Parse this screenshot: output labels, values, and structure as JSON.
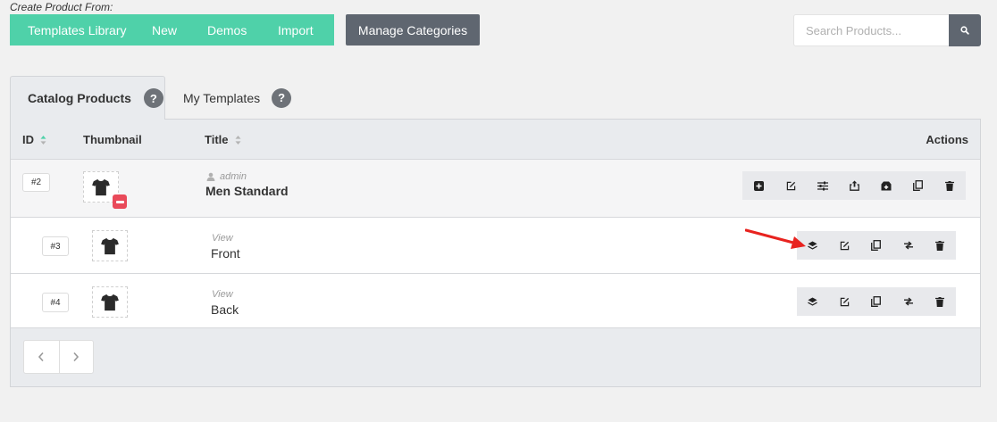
{
  "header": {
    "create_label": "Create Product From:",
    "create_buttons": [
      "Templates Library",
      "New",
      "Demos",
      "Import"
    ],
    "manage_label": "Manage Categories",
    "search_placeholder": "Search Products..."
  },
  "tabs": [
    {
      "label": "Catalog Products",
      "active": true,
      "help": "?"
    },
    {
      "label": "My Templates",
      "active": false,
      "help": "?"
    }
  ],
  "table": {
    "columns": {
      "id": "ID",
      "thumbnail": "Thumbnail",
      "title": "Title",
      "actions": "Actions"
    },
    "product": {
      "id": "#2",
      "author": "admin",
      "title": "Men Standard"
    },
    "views": [
      {
        "id": "#3",
        "meta": "View",
        "title": "Front"
      },
      {
        "id": "#4",
        "meta": "View",
        "title": "Back"
      }
    ]
  },
  "colors": {
    "accent": "#4fd1a9",
    "dark_button": "#5f6670",
    "danger": "#e94a5a",
    "arrow": "#e8231f"
  }
}
